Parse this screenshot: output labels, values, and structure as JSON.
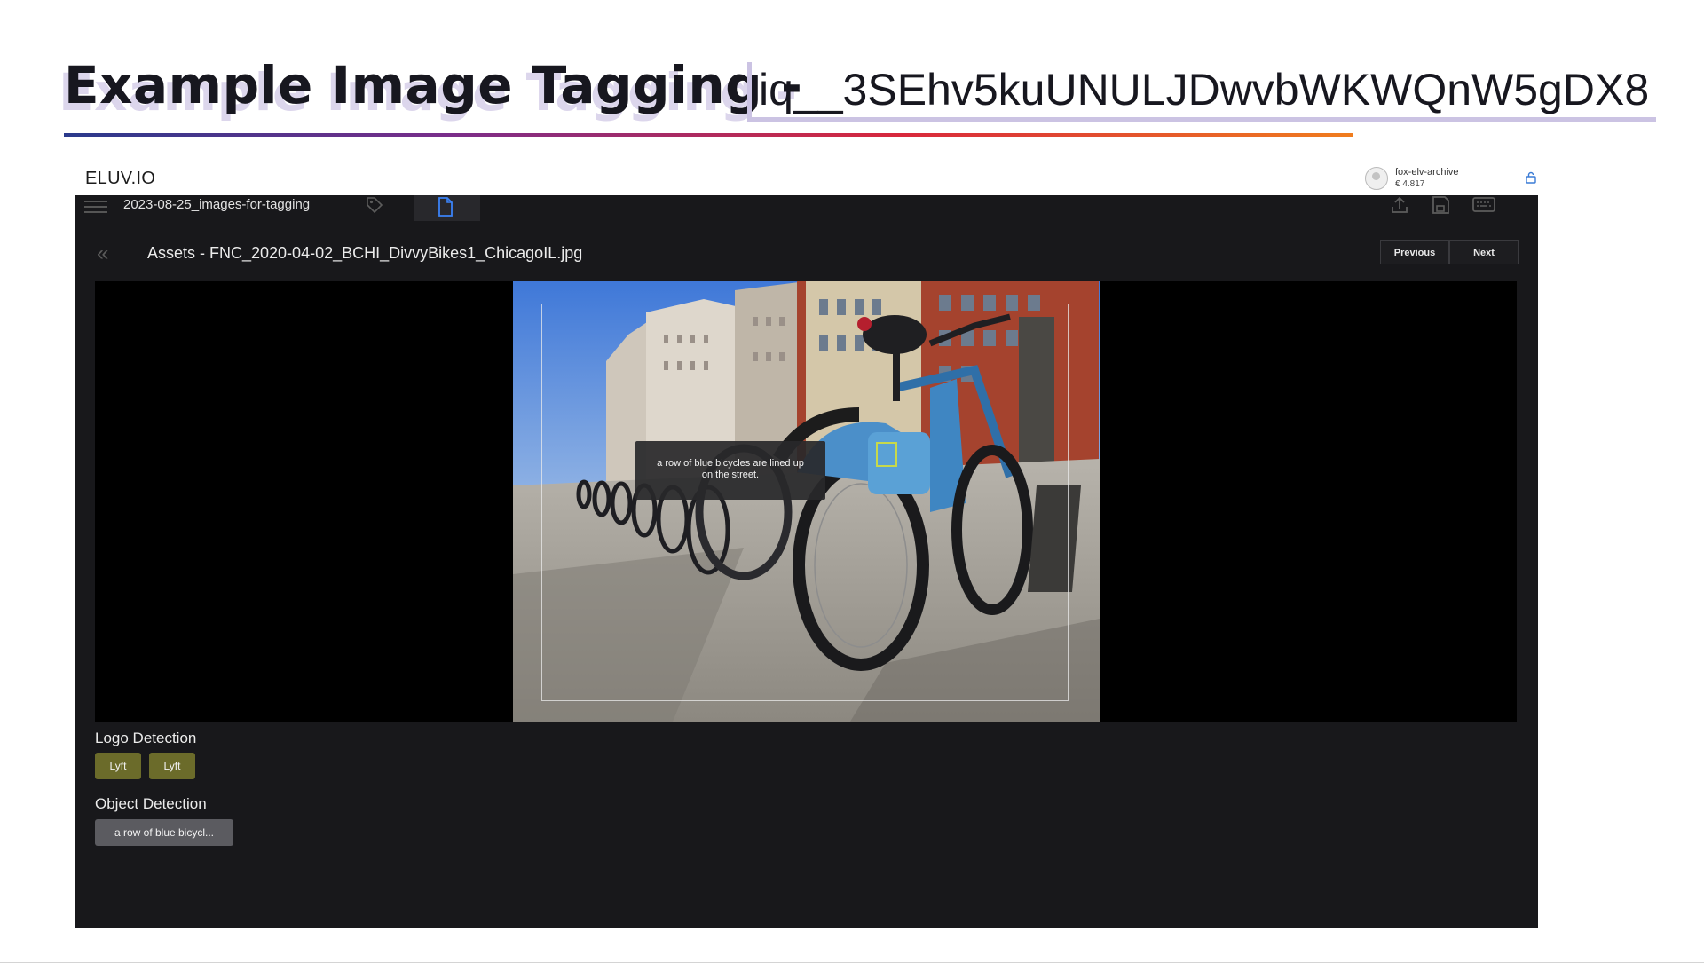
{
  "slide": {
    "title": "Example Image Tagging -",
    "object_id": "iq__3SEhv5kuUNULJDwvbWKWQnW5gDX8"
  },
  "app": {
    "brand": "ELUV.IO",
    "account_name": "fox-elv-archive",
    "account_balance": "€ 4.817",
    "library": "2023-08-25_images-for-tagging",
    "asset_title": "Assets - FNC_2020-04-02_BCHI_DivvyBikes1_ChicagoIL.jpg",
    "nav": {
      "previous": "Previous",
      "next": "Next"
    },
    "back_icon": "«",
    "image_caption": "a row of blue bicycles are lined up on the street.",
    "logo_detection": {
      "label": "Logo Detection",
      "tags": [
        "Lyft",
        "Lyft"
      ]
    },
    "object_detection": {
      "label": "Object Detection",
      "tags": [
        "a row of blue bicycl..."
      ]
    },
    "icons": [
      "hamburger-icon",
      "tag-icon",
      "file-icon",
      "upload-icon",
      "save-icon",
      "keyboard-icon",
      "lock-icon",
      "avatar-icon"
    ],
    "colors": {
      "logo_tag": "#6b6b2a",
      "object_tag": "#5b5b60",
      "lock": "#3a7bd5"
    }
  }
}
